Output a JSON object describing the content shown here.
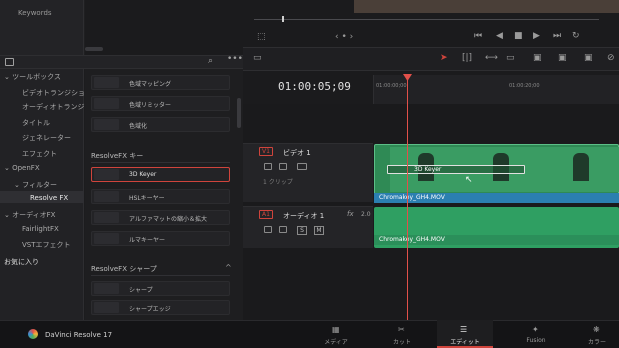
{
  "left_panel": {
    "keywords_label": "Keywords",
    "fx_tree": [
      {
        "label": "ツールボックス"
      },
      {
        "label": "ビデオトランジション"
      },
      {
        "label": "オーディオトランジシ..."
      },
      {
        "label": "タイトル"
      },
      {
        "label": "ジェネレーター"
      },
      {
        "label": "エフェクト"
      },
      {
        "label": "OpenFX"
      },
      {
        "label": "フィルター"
      },
      {
        "label": "Resolve FX"
      },
      {
        "label": "オーディオFX"
      },
      {
        "label": "FairlightFX"
      },
      {
        "label": "VSTエフェクト"
      },
      {
        "label": "お気に入り"
      }
    ],
    "fx_list": {
      "top_items": [
        "色域マッピング",
        "色域リミッター",
        "色域化"
      ],
      "keyer_header": "ResolveFX キー",
      "keyer_items": [
        "3D Keyer",
        "HSLキーヤー",
        "アルファマットの縮小＆拡大",
        "ルマキーヤー"
      ],
      "sharpen_header": "ResolveFX シャープ",
      "sharpen_items": [
        "シャープ",
        "シャープエッジ"
      ]
    }
  },
  "timeline": {
    "timecode": "01:00:05;09",
    "ruler_labels": [
      "01:00:00;00",
      "01:00:20;00"
    ],
    "video_track": {
      "badge": "V1",
      "name": "ビデオ 1",
      "clip_count": "1 クリップ",
      "clip_name": "Chromakey_GH4.MOV",
      "drag_label": "3D Keyer"
    },
    "audio_track": {
      "badge": "A1",
      "name": "オーディオ 1",
      "fx": "fx",
      "level": "2.0",
      "clip_name": "Chromakey_GH4.MOV",
      "s_btn": "S",
      "m_btn": "M"
    }
  },
  "footer": {
    "app_name": "DaVinci Resolve 17",
    "pages": [
      "メディア",
      "カット",
      "エディット",
      "Fusion",
      "カラー"
    ],
    "active_page": "エディット"
  }
}
